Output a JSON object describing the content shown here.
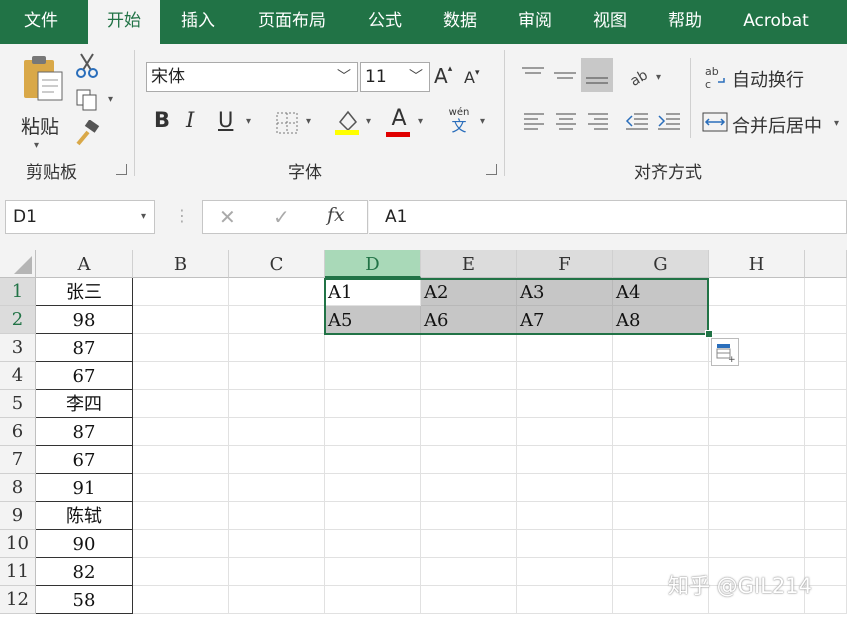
{
  "ribbon": {
    "tabs": [
      "文件",
      "开始",
      "插入",
      "页面布局",
      "公式",
      "数据",
      "审阅",
      "视图",
      "帮助",
      "Acrobat"
    ],
    "active_tab": "开始",
    "clipboard": {
      "paste_label": "粘贴",
      "group_label": "剪贴板"
    },
    "font": {
      "font_name": "宋体",
      "font_size": "11",
      "bold": "B",
      "italic": "I",
      "underline": "U",
      "grow": "A",
      "shrink": "A",
      "font_color": "A",
      "phonetic_top": "wén",
      "phonetic_bottom": "文",
      "group_label": "字体"
    },
    "alignment": {
      "wrap_text_icon": "ab c",
      "wrap_text": "自动换行",
      "merge_center": "合并后居中",
      "group_label": "对齐方式"
    }
  },
  "formula_bar": {
    "name_box": "D1",
    "fx": "fx",
    "formula": "A1"
  },
  "columns": [
    "A",
    "B",
    "C",
    "D",
    "E",
    "F",
    "G",
    "H"
  ],
  "rows": [
    "1",
    "2",
    "3",
    "4",
    "5",
    "6",
    "7",
    "8",
    "9",
    "10",
    "11",
    "12"
  ],
  "column_a": [
    "张三",
    "98",
    "87",
    "67",
    "李四",
    "87",
    "67",
    "91",
    "陈轼",
    "90",
    "82",
    "58"
  ],
  "selection": {
    "row1": [
      "A1",
      "A2",
      "A3",
      "A4"
    ],
    "row2": [
      "A5",
      "A6",
      "A7",
      "A8"
    ]
  },
  "watermark": "知乎 @GIL214",
  "colors": {
    "excel_green": "#217346",
    "selection_gray": "#c6c6c6"
  }
}
